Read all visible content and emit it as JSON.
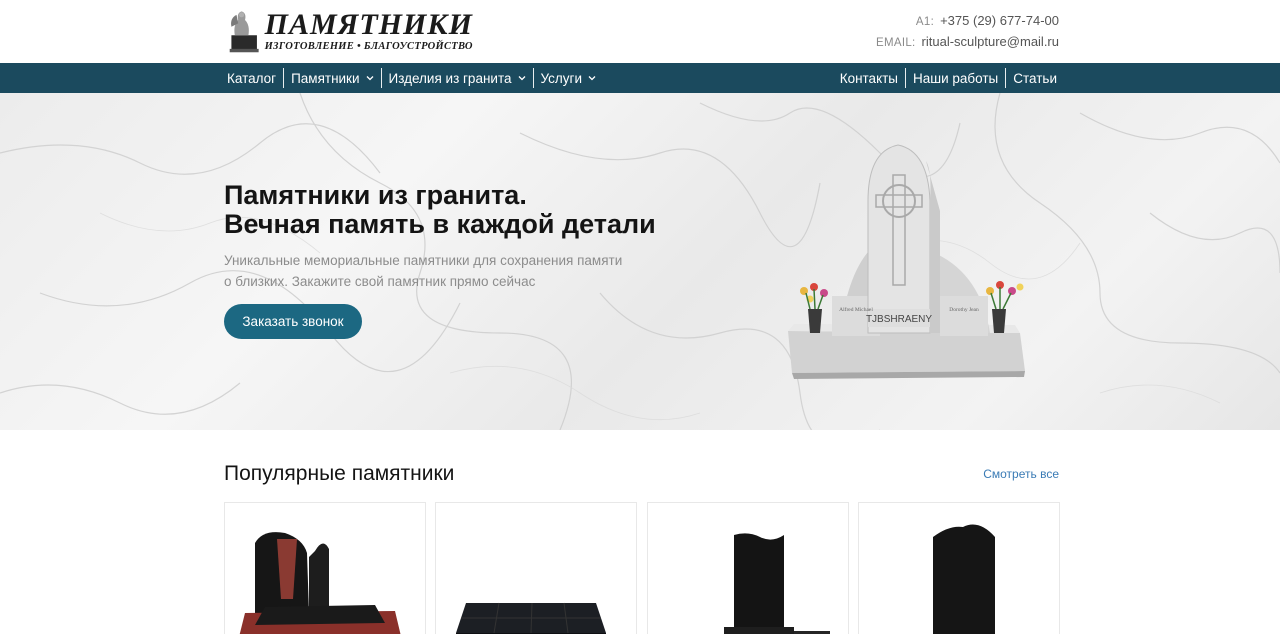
{
  "header": {
    "logo_title": "ПАМЯТНИКИ",
    "logo_subtitle": "ИЗГОТОВЛЕНИЕ • БЛАГОУСТРОЙСТВО",
    "phone_label": "A1:",
    "phone": "+375 (29) 677-74-00",
    "email_label": "EMAIL:",
    "email": "ritual-sculpture@mail.ru"
  },
  "nav": {
    "left": [
      {
        "label": "Каталог",
        "dropdown": false
      },
      {
        "label": "Памятники",
        "dropdown": true
      },
      {
        "label": "Изделия из гранита",
        "dropdown": true
      },
      {
        "label": "Услуги",
        "dropdown": true
      }
    ],
    "right": [
      {
        "label": "Контакты"
      },
      {
        "label": "Наши работы"
      },
      {
        "label": "Статьи"
      }
    ]
  },
  "hero": {
    "title_line1": "Памятники из гранита.",
    "title_line2": "Вечная память в каждой детали",
    "text": "Уникальные мемориальные памятники для сохранения памяти о близких. Закажите свой памятник прямо сейчас",
    "button": "Заказать звонок",
    "monument_name": "TJBSHRAENY",
    "monument_left_name": "Alfred Michael",
    "monument_right_name": "Dorothy Jean"
  },
  "popular": {
    "title": "Популярные памятники",
    "see_all": "Смотреть все"
  },
  "colors": {
    "nav_bg": "#1b4a5e",
    "button_bg": "#1c6882",
    "link": "#3a7bb5"
  }
}
